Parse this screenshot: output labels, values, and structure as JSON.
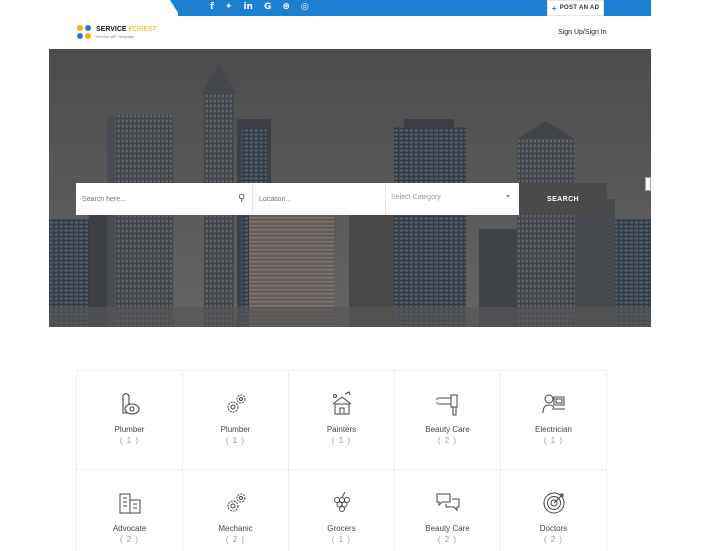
{
  "topbar": {
    "socials": [
      {
        "icon": "facebook-icon",
        "glyph": "f"
      },
      {
        "icon": "twitter-icon",
        "glyph": "✦"
      },
      {
        "icon": "linkedin-icon",
        "glyph": "in"
      },
      {
        "icon": "google-icon",
        "glyph": "G"
      },
      {
        "icon": "pinterest-icon",
        "glyph": "⊛"
      },
      {
        "icon": "instagram-icon",
        "glyph": "◎"
      }
    ],
    "post_ad_label": "POST AN AD"
  },
  "header": {
    "logo_main": "SERVICE",
    "logo_highlight": "FOREST",
    "logo_sub": "Service WP Template",
    "signup_label": "Sign Up/Sign In"
  },
  "search": {
    "keyword_placeholder": "Search here...",
    "location_placeholder": "Location...",
    "category_value": "Select Category",
    "button_label": "SEARCH"
  },
  "categories": [
    {
      "name": "Plumber",
      "count": "( 1 )",
      "icon": "vacuum-cleaner-icon"
    },
    {
      "name": "Plumber",
      "count": "( 1 )",
      "icon": "gears-icon"
    },
    {
      "name": "Painters",
      "count": "( 1 )",
      "icon": "house-paint-icon"
    },
    {
      "name": "Beauty Care",
      "count": "( 2 )",
      "icon": "hair-dryer-icon"
    },
    {
      "name": "Electrician",
      "count": "( 1 )",
      "icon": "technician-icon"
    },
    {
      "name": "Advocate",
      "count": "( 2 )",
      "icon": "buildings-icon"
    },
    {
      "name": "Mechanic",
      "count": "( 2 )",
      "icon": "gears-icon"
    },
    {
      "name": "Grocers",
      "count": "( 1 )",
      "icon": "grapes-icon"
    },
    {
      "name": "Beauty Care",
      "count": "( 2 )",
      "icon": "chat-bubbles-icon"
    },
    {
      "name": "Doctors",
      "count": "( 2 )",
      "icon": "target-icon"
    }
  ],
  "colors": {
    "accent": "#1a80d1",
    "logo_yellow": "#f5b301",
    "search_button": "#4a4a4a"
  }
}
